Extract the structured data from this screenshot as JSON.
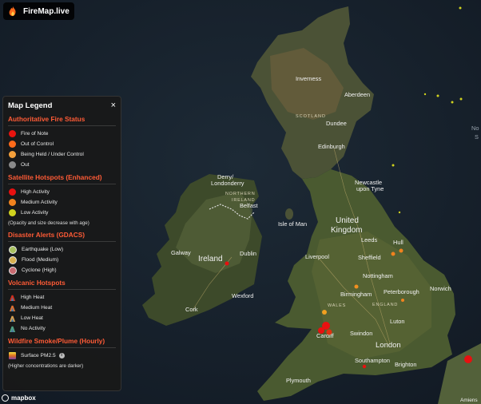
{
  "app": {
    "title": "FireMap.live"
  },
  "legend": {
    "title": "Map Legend",
    "close": "×",
    "sections": {
      "fire_status": {
        "title": "Authoritative Fire Status",
        "items": [
          {
            "label": "Fire of Note",
            "color": "#e8140f"
          },
          {
            "label": "Out of Control",
            "color": "#ff6a1a"
          },
          {
            "label": "Being Held / Under Control",
            "color": "#f5a03b"
          },
          {
            "label": "Out",
            "color": "#8a8a8a"
          }
        ]
      },
      "hotspots": {
        "title": "Satellite Hotspots (Enhanced)",
        "items": [
          {
            "label": "High Activity",
            "color": "#e81010"
          },
          {
            "label": "Medium Activity",
            "color": "#f0821e"
          },
          {
            "label": "Low Activity",
            "color": "#d0d21e"
          }
        ],
        "note": "(Opacity and size decrease with age)"
      },
      "gdacs": {
        "title": "Disaster Alerts (GDACS)",
        "items": [
          {
            "label": "Earthquake (Low)",
            "color": "#a8c060"
          },
          {
            "label": "Flood (Medium)",
            "color": "#d8b050"
          },
          {
            "label": "Cyclone (High)",
            "color": "#c86a70"
          }
        ]
      },
      "volcanic": {
        "title": "Volcanic Hotspots",
        "items": [
          {
            "label": "High Heat",
            "color": "#d03020"
          },
          {
            "label": "Medium Heat",
            "color": "#e07030"
          },
          {
            "label": "Low Heat",
            "color": "#d8a050"
          },
          {
            "label": "No Activity",
            "color": "#50a080"
          }
        ]
      },
      "smoke": {
        "title": "Wildfire Smoke/Plume (Hourly)",
        "item_label": "Surface PM2.5",
        "info": "i",
        "note": "(Higher concentrations are darker)"
      }
    }
  },
  "map": {
    "attribution": "mapbox",
    "labels": {
      "inverness": "Inverness",
      "aberdeen": "Aberdeen",
      "scotland": "SCOTLAND",
      "dundee": "Dundee",
      "edinburgh": "Edinburgh",
      "derry": "Derry/",
      "londonderry": "Londonderry",
      "northern_ireland_1": "NORTHERN",
      "northern_ireland_2": "IRELAND",
      "belfast": "Belfast",
      "newcastle_1": "Newcastle",
      "newcastle_2": "upon Tyne",
      "isle_of_man": "Isle of Man",
      "uk_1": "United",
      "uk_2": "Kingdom",
      "leeds": "Leeds",
      "hull": "Hull",
      "galway": "Galway",
      "ireland": "Ireland",
      "dublin": "Dublin",
      "liverpool": "Liverpool",
      "sheffield": "Sheffield",
      "nottingham": "Nottingham",
      "norwich": "Norwich",
      "birmingham": "Birmingham",
      "peterborough": "Peterborough",
      "wales": "WALES",
      "england": "ENGLAND",
      "cork": "Cork",
      "wexford": "Wexford",
      "luton": "Luton",
      "cardiff": "Cardiff",
      "swindon": "Swindon",
      "london": "London",
      "southampton": "Southampton",
      "brighton": "Brighton",
      "plymouth": "Plymouth",
      "amiens": "Amiens",
      "edge_1": "No",
      "edge_2": "S"
    }
  }
}
